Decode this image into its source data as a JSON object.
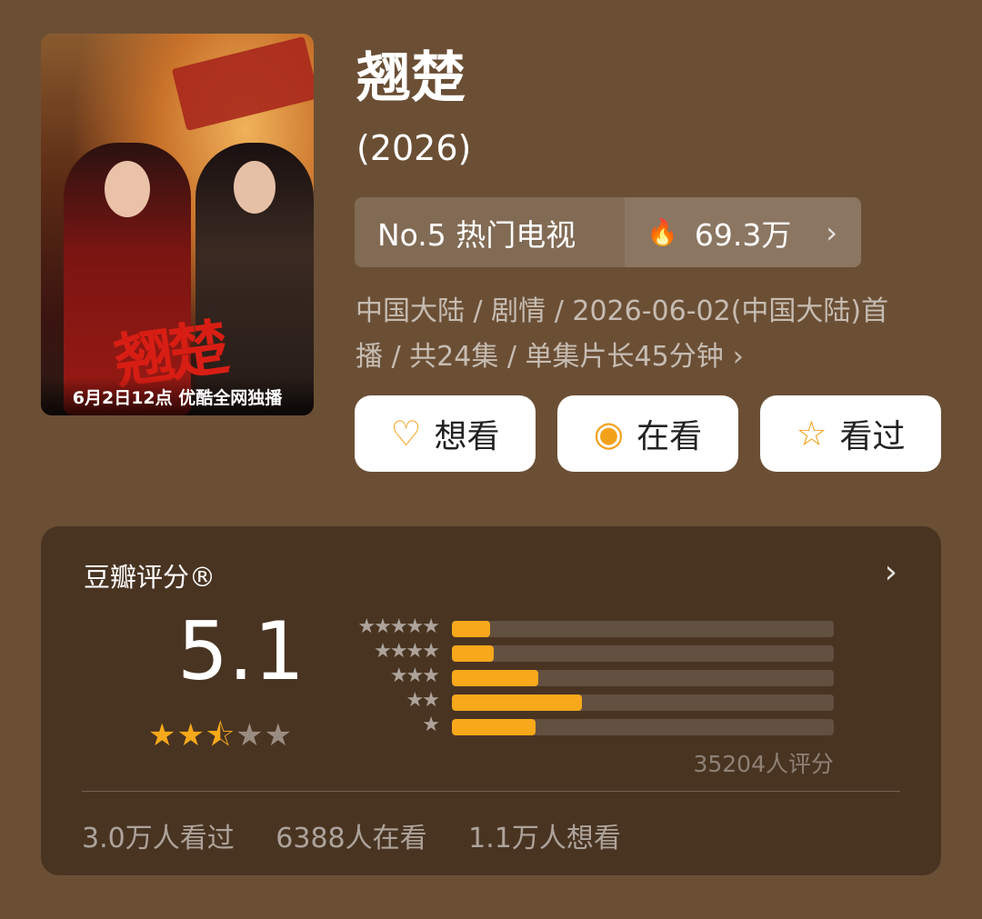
{
  "poster": {
    "calligraphy": "翘楚",
    "caption": "6月2日12点 优酷全网独播"
  },
  "title": "翘楚",
  "year": "(2026)",
  "rank": {
    "label": "No.5 热门电视",
    "heat": "69.3万"
  },
  "meta": {
    "line1": "中国大陆 / 剧情 / 2026-06-02(中国大陆)首",
    "line2": "播 / 共24集 / 单集片长45分钟"
  },
  "buttons": [
    {
      "label": "想看",
      "icon": "heart-plus-icon"
    },
    {
      "label": "在看",
      "icon": "circle-dot-icon"
    },
    {
      "label": "看过",
      "icon": "star-outline-icon"
    }
  ],
  "rating": {
    "label": "豆瓣评分®",
    "score": "5.1",
    "stars": 2.5,
    "distribution": [
      {
        "stars": "★★★★★",
        "fraction": 0.1
      },
      {
        "stars": "★★★★",
        "fraction": 0.11
      },
      {
        "stars": "★★★",
        "fraction": 0.225
      },
      {
        "stars": "★★",
        "fraction": 0.34
      },
      {
        "stars": "★",
        "fraction": 0.22
      }
    ],
    "count": "35204人评分",
    "footer": {
      "watched": "3.0万人看过",
      "watching": "6388人在看",
      "wish": "1.1万人想看"
    }
  },
  "colors": {
    "accent": "#f7a81b",
    "background": "#6b4f35"
  }
}
